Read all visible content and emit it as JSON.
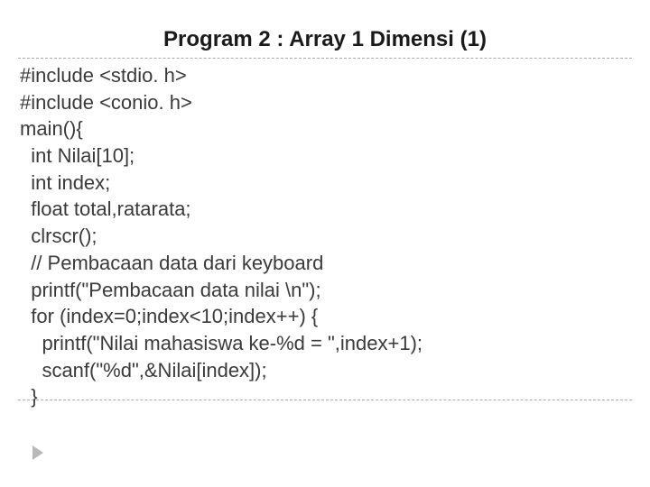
{
  "title": "Program 2 : Array 1 Dimensi (1)",
  "code_lines": [
    "#include <stdio. h>",
    "#include <conio. h>",
    "main(){",
    "  int Nilai[10];",
    "  int index;",
    "  float total,ratarata;",
    "  clrscr();",
    "  // Pembacaan data dari keyboard",
    "  printf(\"Pembacaan data nilai \\n\");",
    "  for (index=0;index<10;index++) {",
    "    printf(\"Nilai mahasiswa ke-%d = \",index+1);",
    "    scanf(\"%d\",&Nilai[index]);",
    "  }"
  ]
}
